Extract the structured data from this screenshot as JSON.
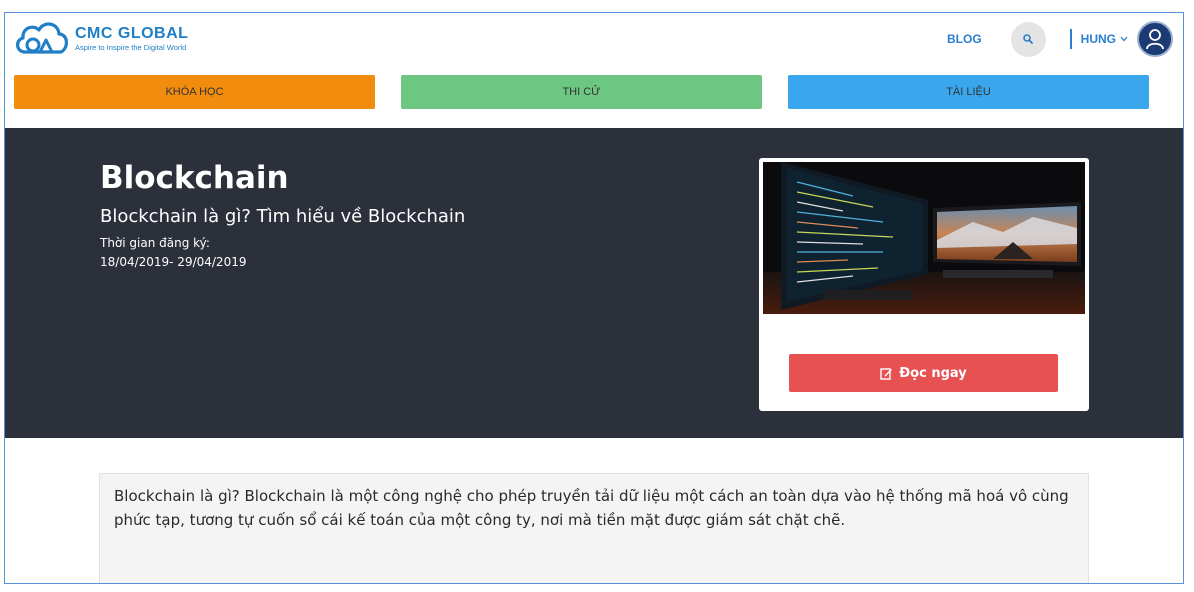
{
  "brand": {
    "name": "CMC GLOBAL",
    "tagline": "Aspire to Inspire the Digital World",
    "color": "#1f7fc6"
  },
  "nav": {
    "blog_label": "BLOG",
    "search_icon": "search-icon",
    "user_name": "HUNG",
    "user_icon": "user-avatar-icon"
  },
  "tabs": [
    {
      "label": "KHÓA HỌC",
      "color": "#f28c0f"
    },
    {
      "label": "THI CỬ",
      "color": "#6cc783"
    },
    {
      "label": "TÀI LIỆU",
      "color": "#39a6ee"
    }
  ],
  "hero": {
    "title": "Blockchain",
    "subtitle": "Blockchain là gì? Tìm hiểu về Blockchain",
    "registration_label": "Thời gian đăng ký:",
    "registration_dates": "18/04/2019- 29/04/2019",
    "background": "#2b303b"
  },
  "card": {
    "read_button_label": "Đọc ngay",
    "read_button_icon": "edit-icon",
    "button_color": "#e85151"
  },
  "content": {
    "description": "Blockchain là gì? Blockchain là một công nghệ cho phép truyền tải dữ liệu một cách an toàn dựa vào hệ thống mã hoá vô cùng phức tạp, tương tự cuốn sổ cái kế toán của một công ty, nơi mà tiền mặt được giám sát chặt chẽ."
  }
}
